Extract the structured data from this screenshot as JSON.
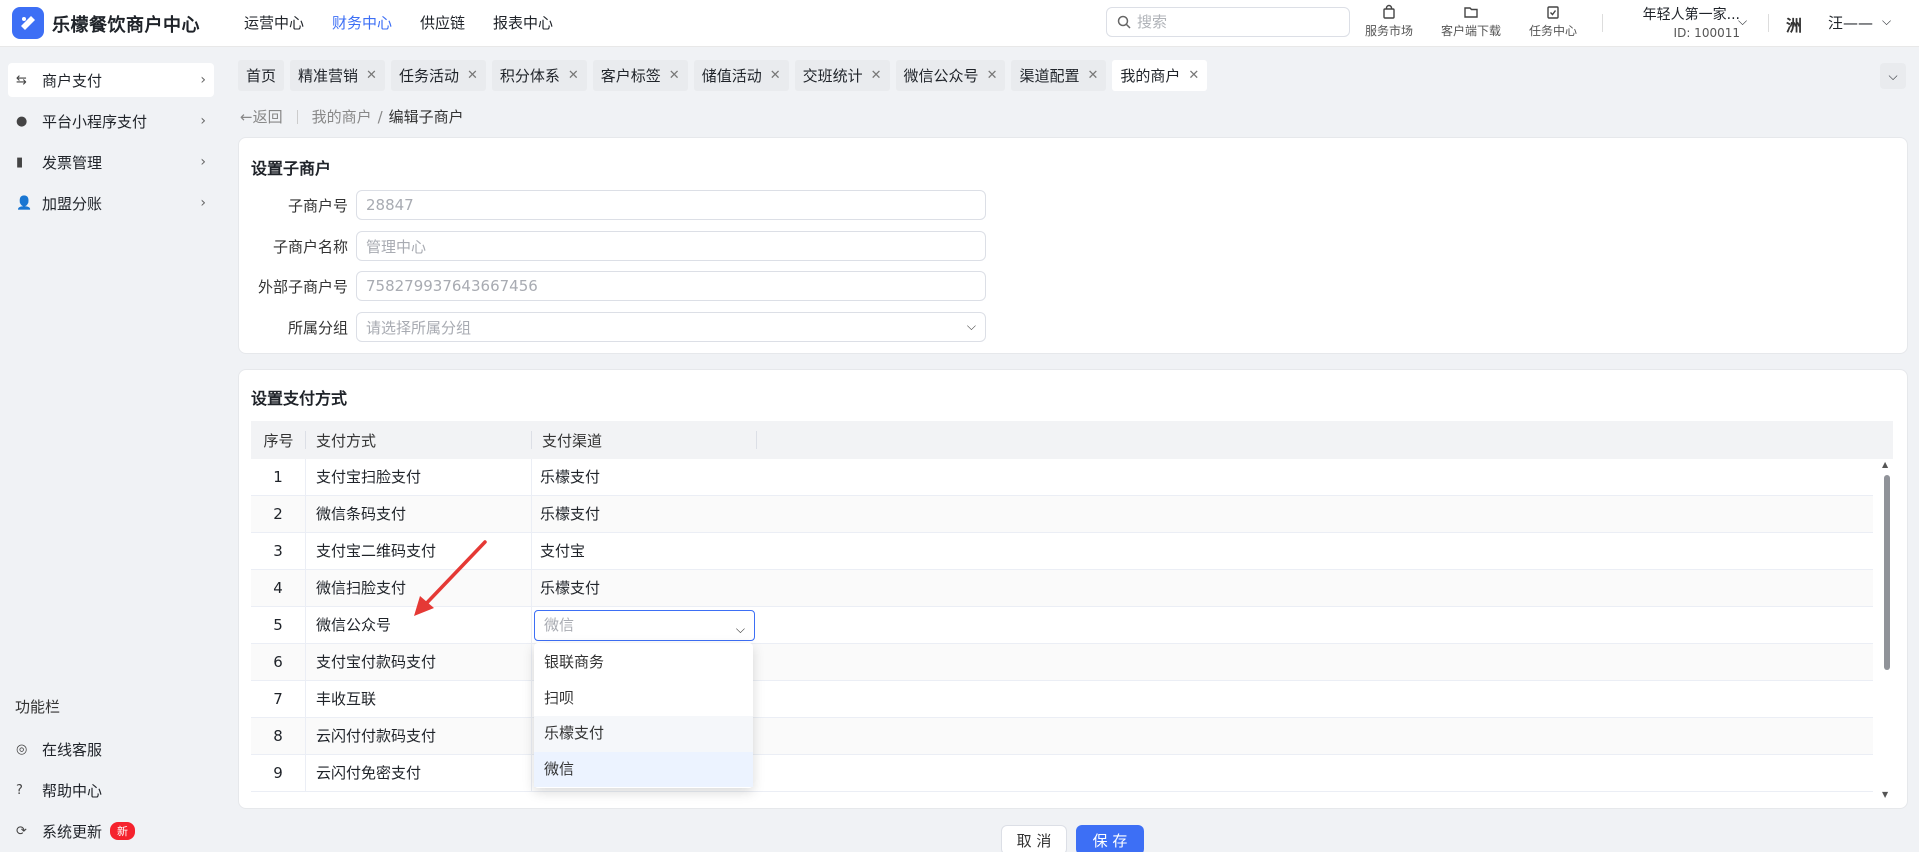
{
  "header": {
    "app_title": "乐檬餐饮商户中心",
    "nav": [
      "运营中心",
      "财务中心",
      "供应链",
      "报表中心"
    ],
    "search_placeholder": "搜索",
    "tools": [
      "服务市场",
      "客户端下载",
      "任务中心"
    ],
    "account_name": "年轻人第一家...",
    "account_id": "ID: 100011",
    "avatar_text": "洲",
    "user_name": "汪——"
  },
  "sidebar": {
    "items": [
      {
        "label": "商户支付"
      },
      {
        "label": "平台小程序支付"
      },
      {
        "label": "发票管理"
      },
      {
        "label": "加盟分账"
      }
    ],
    "section_title": "功能栏",
    "footer_items": [
      {
        "label": "在线客服"
      },
      {
        "label": "帮助中心"
      },
      {
        "label": "系统更新"
      }
    ],
    "new_badge": "新"
  },
  "tabs": [
    {
      "label": "首页"
    },
    {
      "label": "精准营销"
    },
    {
      "label": "任务活动"
    },
    {
      "label": "积分体系"
    },
    {
      "label": "客户标签"
    },
    {
      "label": "储值活动"
    },
    {
      "label": "交班统计"
    },
    {
      "label": "微信公众号"
    },
    {
      "label": "渠道配置"
    },
    {
      "label": "我的商户"
    }
  ],
  "breadcrumb": {
    "back": "返回",
    "parent": "我的商户",
    "separator": "/",
    "current": "编辑子商户"
  },
  "sub_merchant": {
    "title": "设置子商户",
    "fields": [
      {
        "label": "子商户号",
        "value": "28847"
      },
      {
        "label": "子商户名称",
        "value": "管理中心"
      },
      {
        "label": "外部子商户号",
        "value": "758279937643667456"
      },
      {
        "label": "所属分组",
        "placeholder": "请选择所属分组"
      }
    ]
  },
  "payment": {
    "title": "设置支付方式",
    "columns": [
      "序号",
      "支付方式",
      "支付渠道"
    ],
    "rows": [
      {
        "idx": "1",
        "method": "支付宝扫脸支付",
        "channel": "乐檬支付"
      },
      {
        "idx": "2",
        "method": "微信条码支付",
        "channel": "乐檬支付"
      },
      {
        "idx": "3",
        "method": "支付宝二维码支付",
        "channel": "支付宝"
      },
      {
        "idx": "4",
        "method": "微信扫脸支付",
        "channel": "乐檬支付"
      },
      {
        "idx": "5",
        "method": "微信公众号",
        "channel_select": "微信"
      },
      {
        "idx": "6",
        "method": "支付宝付款码支付",
        "channel": ""
      },
      {
        "idx": "7",
        "method": "丰收互联",
        "channel": ""
      },
      {
        "idx": "8",
        "method": "云闪付付款码支付",
        "channel": ""
      },
      {
        "idx": "9",
        "method": "云闪付免密支付",
        "channel": ""
      }
    ],
    "dropdown_options": [
      "银联商务",
      "扫呗",
      "乐檬支付",
      "微信"
    ],
    "dropdown_selected": "微信"
  },
  "actions": {
    "cancel": "取 消",
    "save": "保 存"
  },
  "colors": {
    "accent": "#3d6ff5",
    "badge": "#f5222d",
    "arrow": "#e53935"
  }
}
